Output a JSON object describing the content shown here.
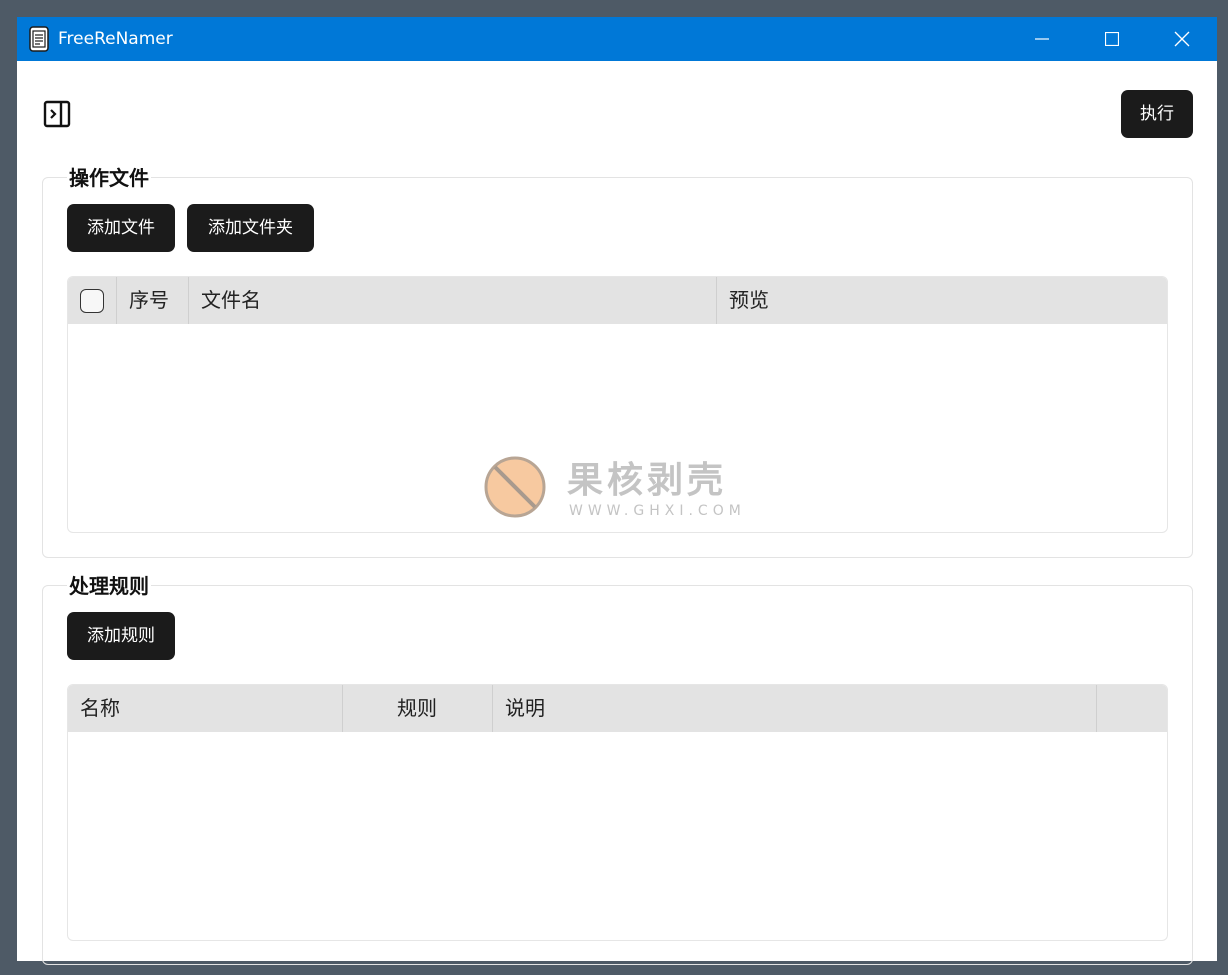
{
  "window": {
    "title": "FreeReNamer"
  },
  "toolbar": {
    "run_label": "执行"
  },
  "files_section": {
    "title": "操作文件",
    "add_file_label": "添加文件",
    "add_folder_label": "添加文件夹",
    "columns": [
      "序号",
      "文件名",
      "预览"
    ]
  },
  "rules_section": {
    "title": "处理规则",
    "add_rule_label": "添加规则",
    "columns": [
      "名称",
      "规则",
      "说明",
      ""
    ]
  },
  "watermark": {
    "text": "果核剥壳",
    "url": "WWW.GHXI.COM"
  },
  "colors": {
    "titlebar": "#0078d7",
    "button_dark": "#1b1b1b",
    "table_header": "#e3e3e3"
  }
}
